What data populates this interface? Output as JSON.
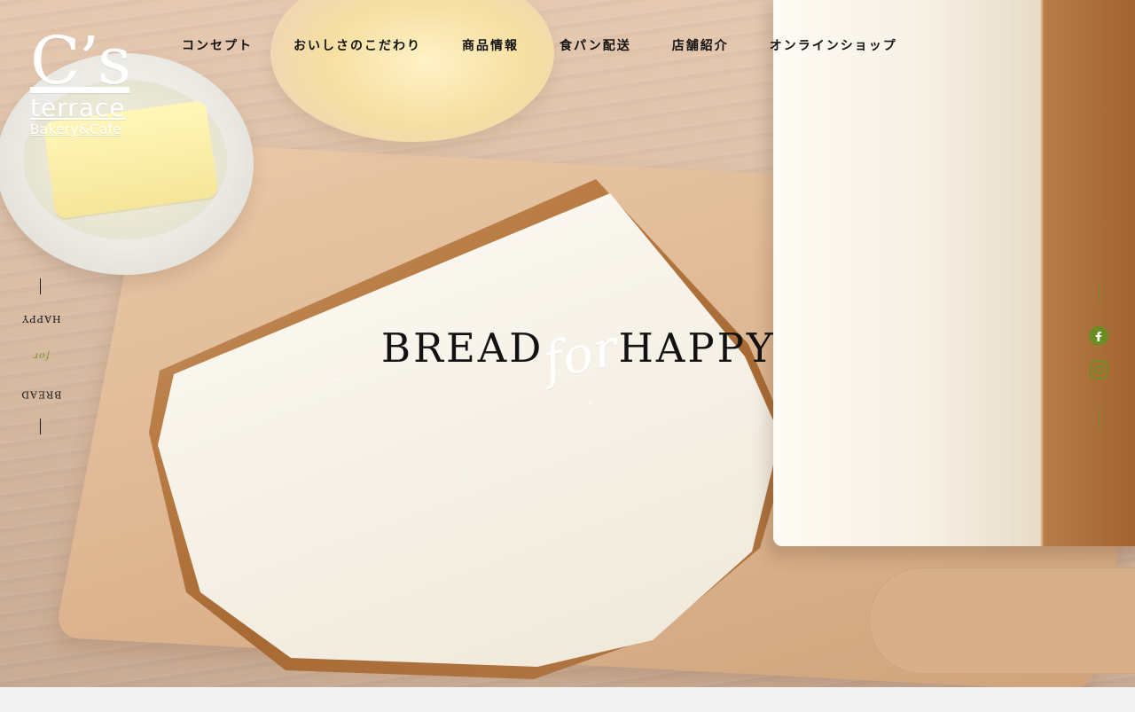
{
  "brand": {
    "logo_mark": "C’s",
    "logo_name": "terrace",
    "logo_sub": "Bakery&Cafe"
  },
  "nav": {
    "items": [
      {
        "label": "コンセプト"
      },
      {
        "label": "おいしさのこだわり"
      },
      {
        "label": "商品情報"
      },
      {
        "label": "食パン配送"
      },
      {
        "label": "店舗紹介"
      },
      {
        "label": "オンラインショップ"
      }
    ]
  },
  "hero": {
    "title_left": "BREAD",
    "title_script": "for",
    "title_right": "HAPPY"
  },
  "side_left": {
    "text_left": "BREAD",
    "text_script": "for",
    "text_right": "HAPPY"
  },
  "social": {
    "icons": [
      {
        "name": "facebook-icon"
      },
      {
        "name": "instagram-icon"
      }
    ]
  },
  "colors": {
    "accent": "#6b8e23",
    "text": "#121212",
    "page_bg": "#f2f2f2"
  }
}
